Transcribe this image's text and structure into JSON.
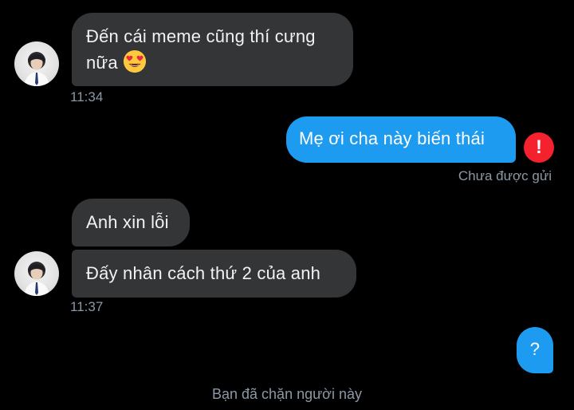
{
  "conversation": {
    "group1": {
      "message1_line1": "Đến cái meme cũng thí cưng",
      "message1_line2": "nữa",
      "emoji": "smiling-face-with-heart-eyes-icon",
      "time": "11:34"
    },
    "outgoing1": {
      "text": "Mẹ ơi cha này biến thái",
      "status": "Chưa được gửi",
      "error_icon_label": "!"
    },
    "group2": {
      "message1": "Anh xin lỗi",
      "message2": "Đấy nhân cách thứ 2 của anh",
      "time": "11:37"
    },
    "outgoing2": {
      "text": "?"
    },
    "blocked_notice": "Bạn đã chặn người này"
  },
  "colors": {
    "background": "#000000",
    "incoming_bubble": "#333536",
    "outgoing_bubble": "#1d9bf0",
    "error": "#f4212e",
    "secondary_text": "#8b98a5"
  }
}
